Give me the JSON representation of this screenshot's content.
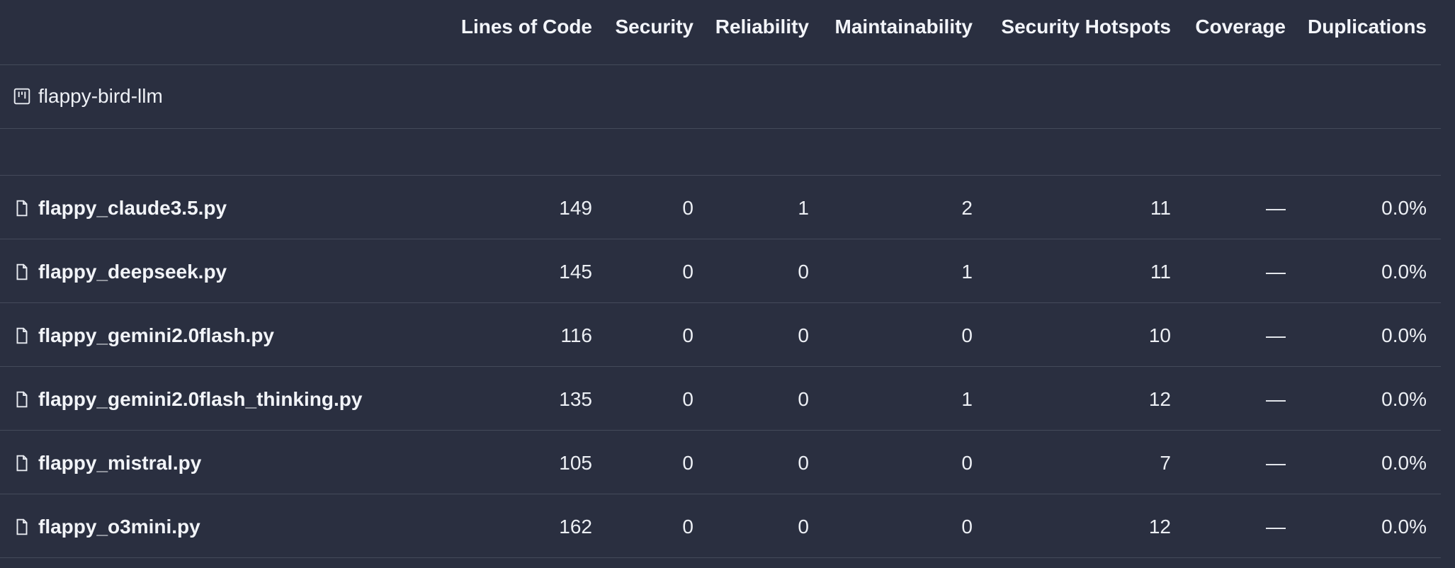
{
  "table": {
    "headers": [
      "Lines of Code",
      "Security",
      "Reliability",
      "Maintainability",
      "Security Hotspots",
      "Coverage",
      "Duplications"
    ],
    "project": {
      "name": "flappy-bird-llm",
      "icon": "project-icon"
    },
    "rows": [
      {
        "name": "flappy_claude3.5.py",
        "lines_of_code": "149",
        "security": "0",
        "reliability": "1",
        "maintainability": "2",
        "security_hotspots": "11",
        "coverage": "—",
        "duplications": "0.0%"
      },
      {
        "name": "flappy_deepseek.py",
        "lines_of_code": "145",
        "security": "0",
        "reliability": "0",
        "maintainability": "1",
        "security_hotspots": "11",
        "coverage": "—",
        "duplications": "0.0%"
      },
      {
        "name": "flappy_gemini2.0flash.py",
        "lines_of_code": "116",
        "security": "0",
        "reliability": "0",
        "maintainability": "0",
        "security_hotspots": "10",
        "coverage": "—",
        "duplications": "0.0%"
      },
      {
        "name": "flappy_gemini2.0flash_thinking.py",
        "lines_of_code": "135",
        "security": "0",
        "reliability": "0",
        "maintainability": "1",
        "security_hotspots": "12",
        "coverage": "—",
        "duplications": "0.0%"
      },
      {
        "name": "flappy_mistral.py",
        "lines_of_code": "105",
        "security": "0",
        "reliability": "0",
        "maintainability": "0",
        "security_hotspots": "7",
        "coverage": "—",
        "duplications": "0.0%"
      },
      {
        "name": "flappy_o3mini.py",
        "lines_of_code": "162",
        "security": "0",
        "reliability": "0",
        "maintainability": "0",
        "security_hotspots": "12",
        "coverage": "—",
        "duplications": "0.0%"
      }
    ],
    "icons": {
      "file": "file-icon"
    },
    "colors": {
      "background": "#2a2f40",
      "divider": "#444a5a",
      "text": "#eef0f5"
    }
  }
}
